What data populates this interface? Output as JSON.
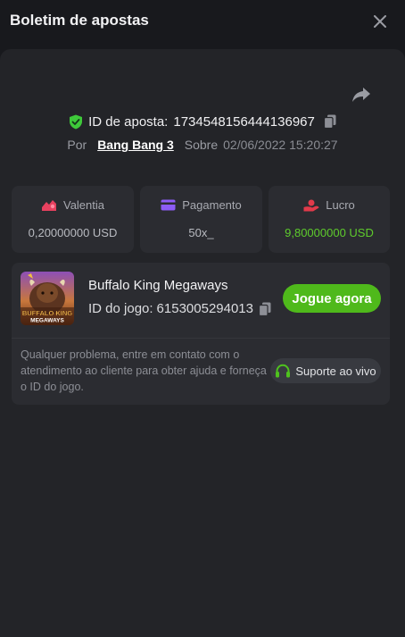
{
  "header": {
    "title": "Boletim de apostas"
  },
  "bet": {
    "id_label": "ID de aposta:",
    "id_value": "1734548156444136967",
    "by_label": "Por",
    "game_link": "Bang Bang 3",
    "about_label": "Sobre",
    "date": "02/06/2022 15:20:27"
  },
  "stats": [
    {
      "label": "Valentia",
      "value": "0,20000000 USD"
    },
    {
      "label": "Pagamento",
      "value": "50x_"
    },
    {
      "label": "Lucro",
      "value": "9,80000000 USD"
    }
  ],
  "game": {
    "name": "Buffalo King Megaways",
    "id_label": "ID do jogo:",
    "id_value": "6153005294013",
    "play_label": "Jogue agora",
    "thumb_text_1": "BUFFALO KING",
    "thumb_text_2": "MEGAWAYS",
    "help_text": "Qualquer problema, entre em contato com o atendimento ao cliente para obter ajuda e forneça o ID do jogo.",
    "support_label": "Suporte ao vivo"
  },
  "colors": {
    "accent_green": "#4fb91b",
    "profit_green": "#5ecb2c",
    "shield_green": "#3ec93a",
    "stake_icon": "#e8415f",
    "payout_icon": "#8d5cf6",
    "profit_icon": "#e23a4a"
  },
  "icons": [
    "close-icon",
    "share-icon",
    "shield-check-icon",
    "copy-icon",
    "stake-icon",
    "card-icon",
    "profit-icon",
    "headset-icon"
  ]
}
